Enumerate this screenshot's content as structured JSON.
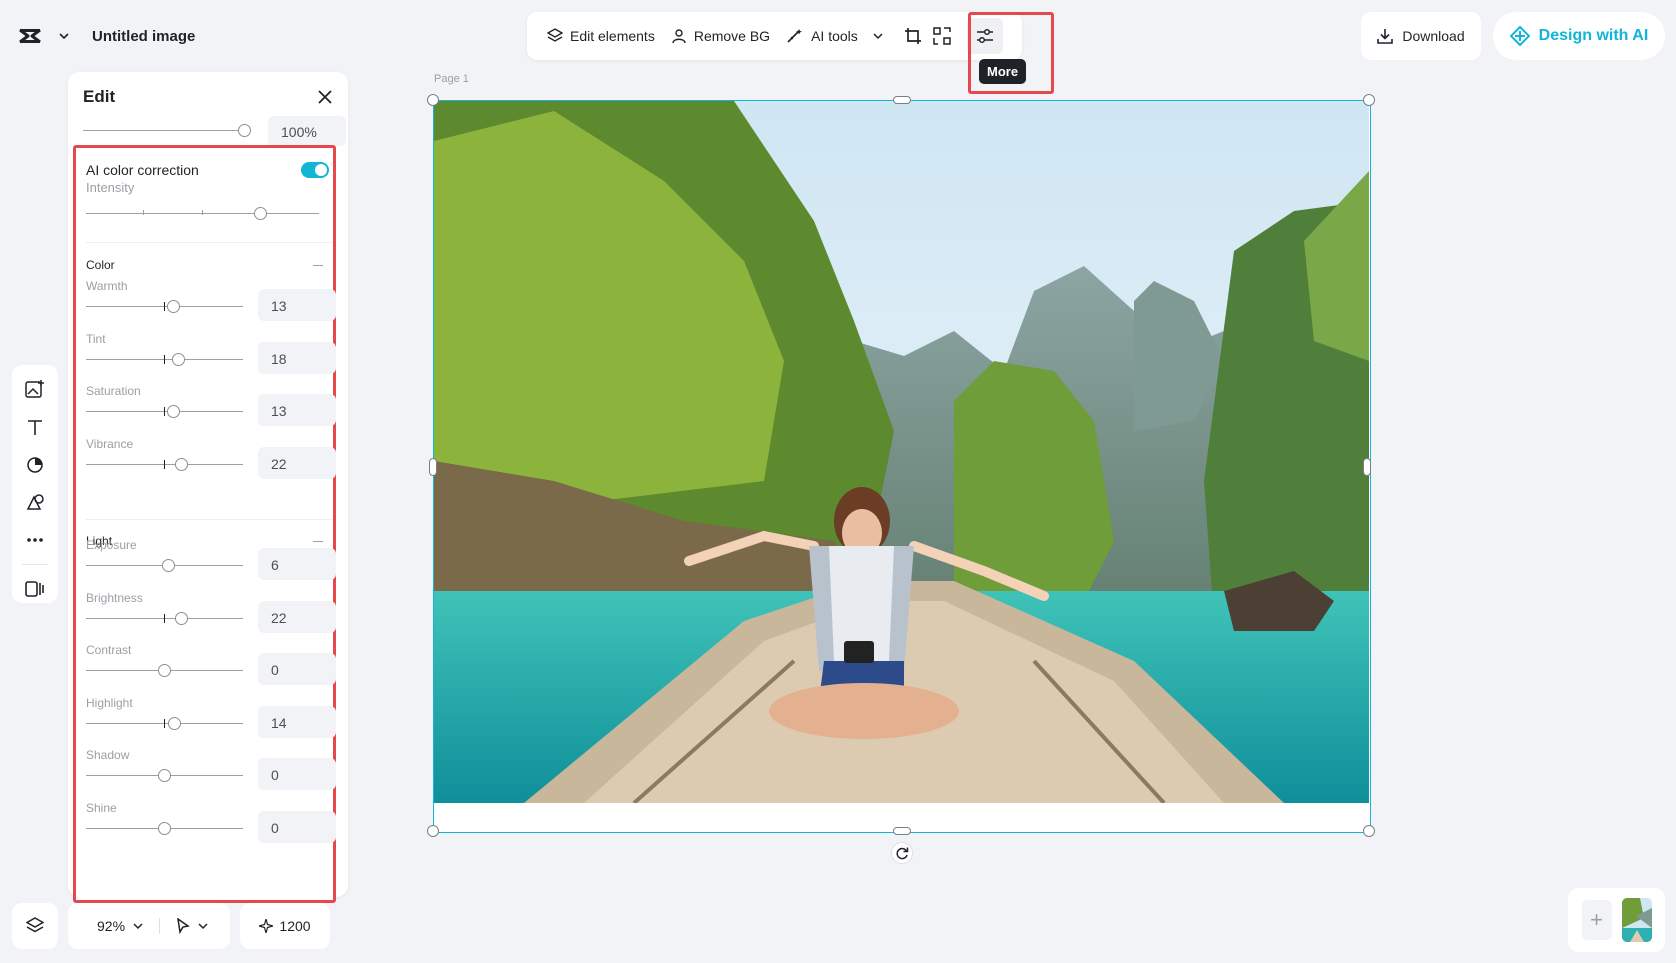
{
  "app": {
    "doc_title": "Untitled image",
    "logo_icon": "capcut-logo-icon",
    "accent_color": "#12b5d6",
    "highlight_color": "#e5484d"
  },
  "toolbar": {
    "edit_elements": "Edit elements",
    "remove_bg": "Remove BG",
    "ai_tools": "AI tools",
    "crop_icon": "crop-icon",
    "qr_icon": "qr-scan-icon",
    "more_icon": "sliders-icon",
    "more_tooltip": "More"
  },
  "actions": {
    "download": "Download",
    "design_with_ai": "Design with AI"
  },
  "edit_panel": {
    "title": "Edit",
    "top_value": "100%",
    "ai_color_correction": {
      "label": "AI color correction",
      "enabled": true,
      "intensity_label": "Intensity",
      "intensity": 0.75
    },
    "color_group": {
      "title": "Color",
      "items": [
        {
          "label": "Warmth",
          "value": "13",
          "level": 0.56
        },
        {
          "label": "Tint",
          "value": "18",
          "level": 0.59
        },
        {
          "label": "Saturation",
          "value": "13",
          "level": 0.56
        },
        {
          "label": "Vibrance",
          "value": "22",
          "level": 0.61
        }
      ]
    },
    "light_group": {
      "title": "Light",
      "items": [
        {
          "label": "Exposure",
          "value": "6",
          "level": 0.53
        },
        {
          "label": "Brightness",
          "value": "22",
          "level": 0.61
        },
        {
          "label": "Contrast",
          "value": "0",
          "level": 0.5
        },
        {
          "label": "Highlight",
          "value": "14",
          "level": 0.57
        },
        {
          "label": "Shadow",
          "value": "0",
          "level": 0.5
        },
        {
          "label": "Shine",
          "value": "0",
          "level": 0.5
        }
      ]
    }
  },
  "canvas": {
    "page_label": "Page 1"
  },
  "bottom": {
    "zoom": "92%",
    "credits": "1200"
  }
}
